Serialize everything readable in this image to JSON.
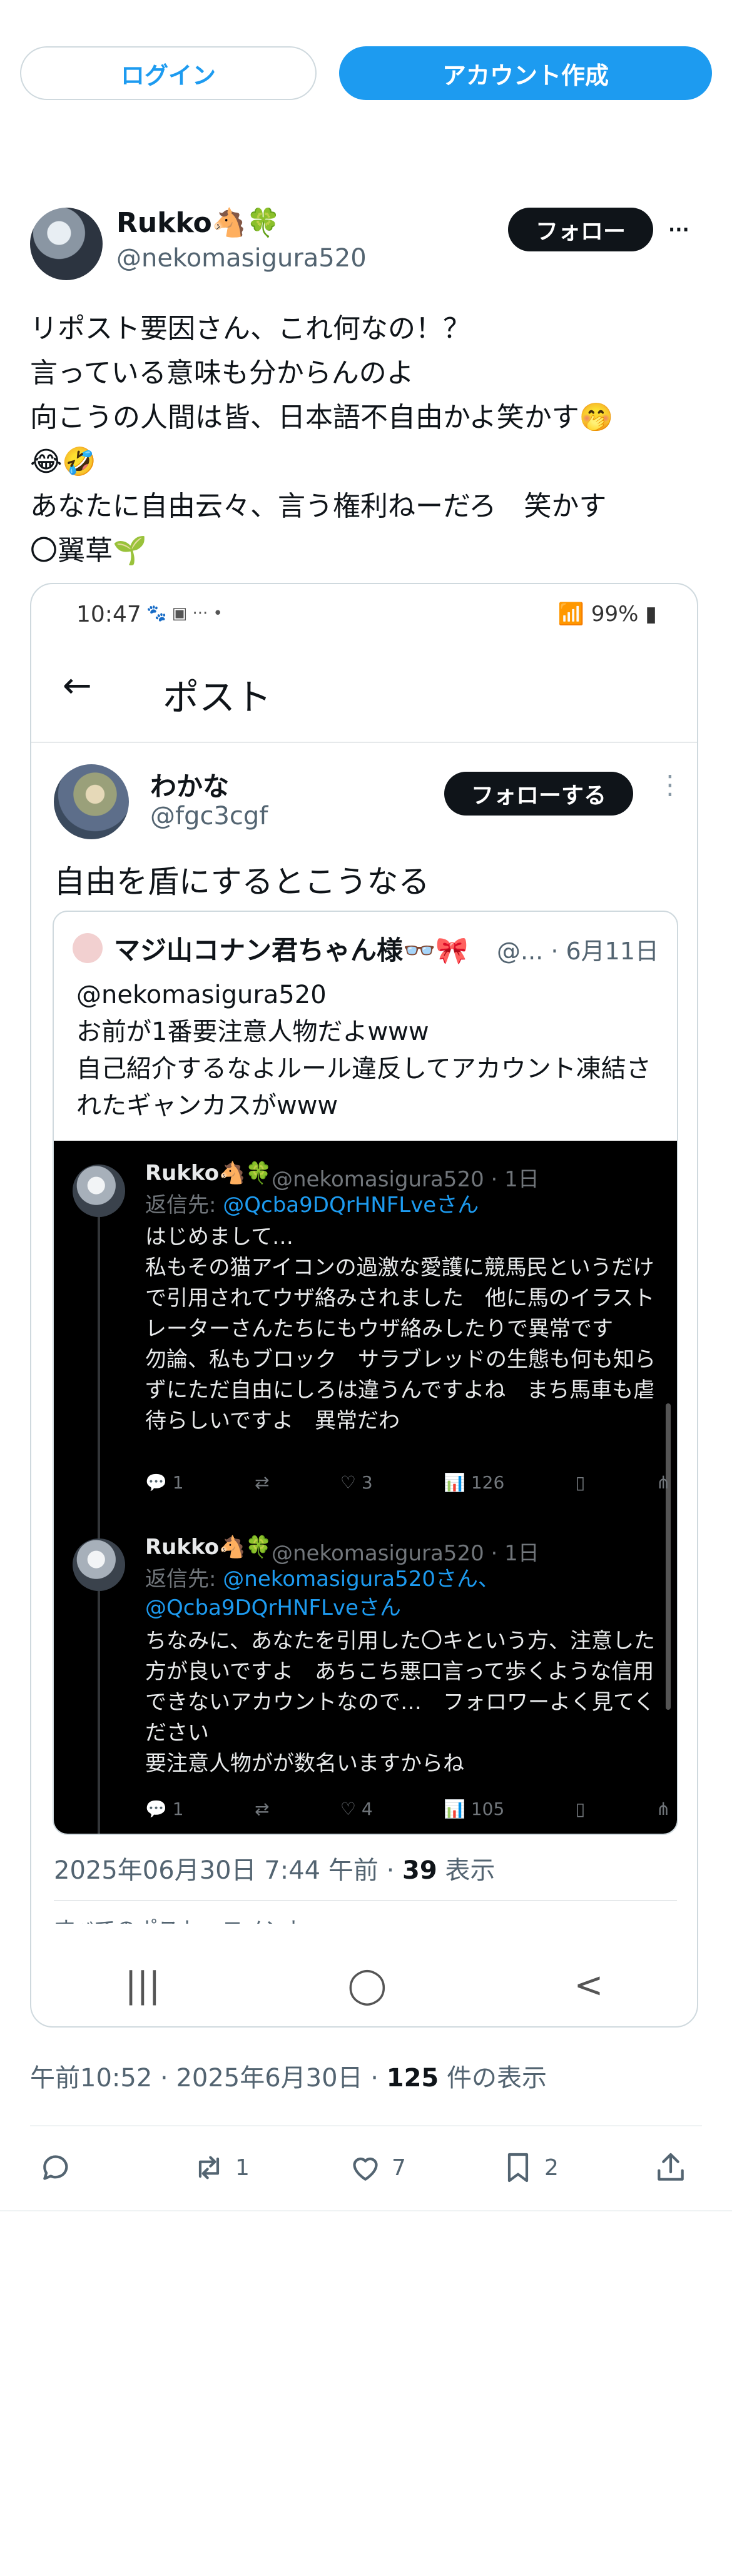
{
  "header": {
    "login_label": "ログイン",
    "signup_label": "アカウント作成"
  },
  "tweet": {
    "author_name": "Rukko🐴🍀",
    "author_handle": "@nekomasigura520",
    "follow_label": "フォロー",
    "more_label": "···",
    "text": "リポスト要因さん、これ何なの！？\n言っている意味も分からんのよ\n向こうの人間は皆、日本語不自由かよ笑かす🤭\n😂🤣\nあなたに自由云々、言う権利ねーだろ　笑かす\n〇翼草🌱",
    "meta": {
      "time": "午前10:52",
      "date": "2025年6月30日",
      "views": "125",
      "views_suffix": "件の表示"
    },
    "actions": {
      "reply_count": "",
      "retweet_count": "1",
      "like_count": "7",
      "bookmark_count": "2"
    }
  },
  "screenshot": {
    "status_bar": {
      "time": "10:47",
      "icons": "🐾 ▣ ··· •",
      "battery": "99%"
    },
    "app_bar": {
      "back_icon": "←",
      "title": "ポスト"
    },
    "post": {
      "author_name": "わかな",
      "author_handle": "@fgc3cgf",
      "follow_label": "フォローする",
      "more_label": "⋮",
      "text": "自由を盾にするとこうなる",
      "quote": {
        "author_name": "マジ山コナン君ちゃん様👓🎀",
        "meta": "@... · 6月11日",
        "text": "@nekomasigura520\nお前が1番要注意人物だよwww\n自己紹介するなよルール違反してアカウント凍結されたギャンカスがwww",
        "replies": [
          {
            "name": "Rukko🐴🍀",
            "handle": "@nekomasigura520 · 1日",
            "reply_prefix": "返信先: ",
            "reply_to": "@Qcba9DQrHNFLveさん",
            "text": "はじめまして…\n私もその猫アイコンの過激な愛護に競馬民というだけで引用されてウザ絡みされました　他に馬のイラストレーターさんたちにもウザ絡みしたりで異常です\n勿論、私もブロック　サラブレッドの生態も何も知らずにただ自由にしろは違うんですよね　まち馬車も虐待らしいですよ　異常だわ",
            "reply_count": "1",
            "retweet_count": "",
            "like_count": "3",
            "view_count": "126"
          },
          {
            "name": "Rukko🐴🍀",
            "handle": "@nekomasigura520 · 1日",
            "reply_prefix": "返信先: ",
            "reply_to": "@nekomasigura520さん、@Qcba9DQrHNFLveさん",
            "text": "ちなみに、あなたを引用した〇キという方、注意した方が良いですよ　あちこち悪口言って歩くような信用できないアカウントなので…　フォロワーよく見てください\n要注意人物がが数名いますからね",
            "reply_count": "1",
            "retweet_count": "",
            "like_count": "4",
            "view_count": "105"
          }
        ]
      },
      "timestamp": "2025年06月30日 7:44 午前",
      "views": "39",
      "views_suffix": "表示",
      "peek_text": "すべてのポスト・コメント"
    },
    "nav": {
      "recents": "|||",
      "home": "◯",
      "back": "<"
    }
  }
}
